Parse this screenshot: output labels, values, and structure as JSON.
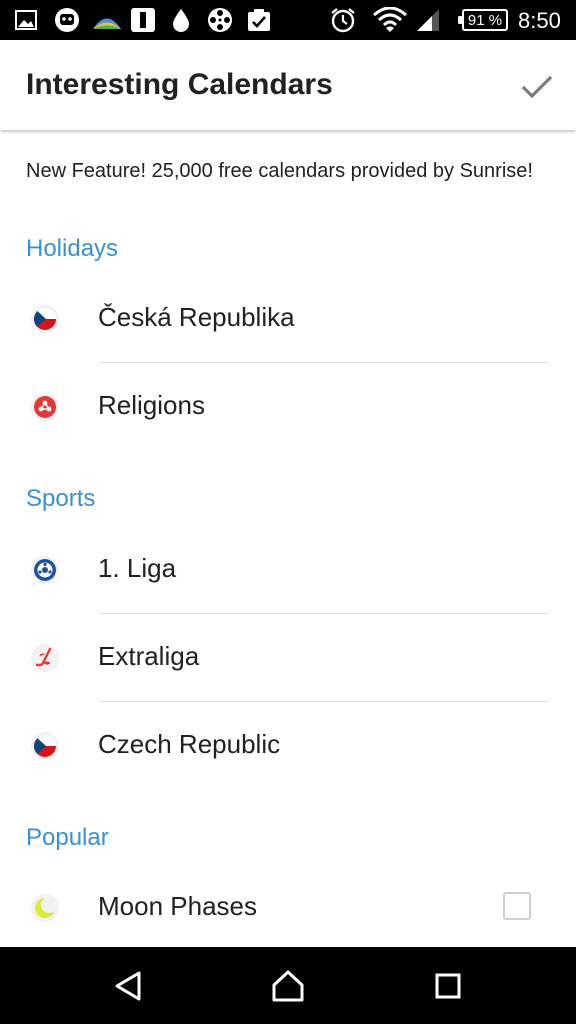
{
  "status_bar": {
    "battery": "91 %",
    "time": "8:50",
    "icons": [
      "image-icon",
      "android-robot-icon",
      "landscape-icon",
      "sim-card-icon",
      "water-drop-icon",
      "film-reel-icon",
      "clipboard-check-icon",
      "alarm-clock-icon",
      "wifi-icon",
      "cell-signal-icon",
      "battery-icon"
    ]
  },
  "app_bar": {
    "title": "Interesting Calendars",
    "confirm_icon": "checkmark-icon"
  },
  "feature_note": "New Feature! 25,000 free calendars provided by Sunrise!",
  "sections": [
    {
      "title": "Holidays",
      "items": [
        {
          "label": "Česká Republika",
          "icon": "czech-flag-icon"
        },
        {
          "label": "Religions",
          "icon": "religions-icon"
        }
      ]
    },
    {
      "title": "Sports",
      "items": [
        {
          "label": "1. Liga",
          "icon": "soccer-ball-icon"
        },
        {
          "label": "Extraliga",
          "icon": "hockey-icon"
        },
        {
          "label": "Czech Republic",
          "icon": "czech-flag-icon"
        }
      ]
    },
    {
      "title": "Popular",
      "items": [
        {
          "label": "Moon Phases",
          "icon": "moon-icon",
          "checked": false
        }
      ]
    }
  ],
  "nav_bar": {
    "back_icon": "back-triangle-icon",
    "home_icon": "home-icon",
    "recents_icon": "recents-square-icon"
  },
  "colors": {
    "accent": "#3a8fd9",
    "text": "#212121",
    "czech_red": "#d7141a",
    "czech_blue": "#11457e",
    "religions_red": "#e53935",
    "moon_yellow": "#d8ec3a"
  }
}
